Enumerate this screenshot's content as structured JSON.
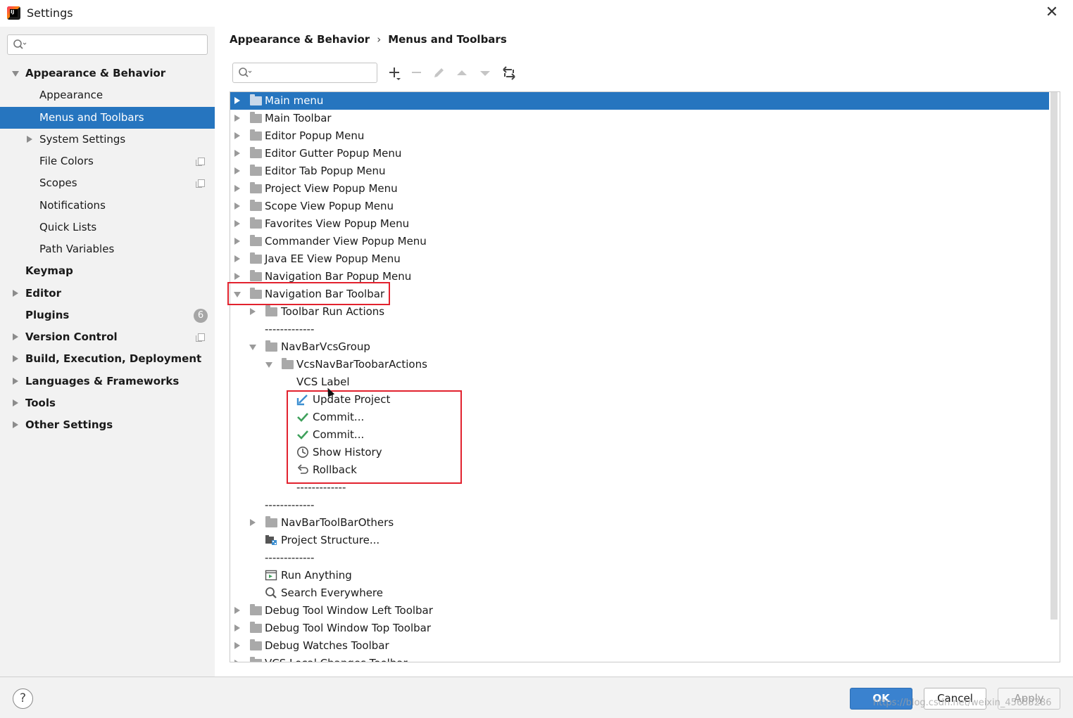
{
  "window": {
    "title": "Settings",
    "close_icon": "close-icon"
  },
  "sidebar": {
    "search_placeholder": "",
    "items": [
      {
        "label": "Appearance & Behavior",
        "bold": true,
        "expanded": true
      },
      {
        "label": "Appearance"
      },
      {
        "label": "Menus and Toolbars",
        "selected": true
      },
      {
        "label": "System Settings",
        "collapsed": true
      },
      {
        "label": "File Colors",
        "copy_icon": true
      },
      {
        "label": "Scopes",
        "copy_icon": true
      },
      {
        "label": "Notifications"
      },
      {
        "label": "Quick Lists"
      },
      {
        "label": "Path Variables"
      },
      {
        "label": "Keymap",
        "bold": true
      },
      {
        "label": "Editor",
        "bold": true,
        "collapsed": true
      },
      {
        "label": "Plugins",
        "bold": true,
        "badge": "6"
      },
      {
        "label": "Version Control",
        "bold": true,
        "collapsed": true,
        "copy_icon": true
      },
      {
        "label": "Build, Execution, Deployment",
        "bold": true,
        "collapsed": true
      },
      {
        "label": "Languages & Frameworks",
        "bold": true,
        "collapsed": true
      },
      {
        "label": "Tools",
        "bold": true,
        "collapsed": true
      },
      {
        "label": "Other Settings",
        "bold": true,
        "collapsed": true
      }
    ]
  },
  "breadcrumb": {
    "parent": "Appearance & Behavior",
    "separator": "›",
    "current": "Menus and Toolbars"
  },
  "toolbar": {
    "search_placeholder": "",
    "add_icon": "+",
    "remove_icon": "−",
    "edit_icon": "✎",
    "move_up_icon": "▲",
    "move_down_icon": "▼",
    "restore_icon": "⟲"
  },
  "tree": {
    "rows": [
      {
        "label": "Main menu"
      },
      {
        "label": "Main Toolbar"
      },
      {
        "label": "Editor Popup Menu"
      },
      {
        "label": "Editor Gutter Popup Menu"
      },
      {
        "label": "Editor Tab Popup Menu"
      },
      {
        "label": "Project View Popup Menu"
      },
      {
        "label": "Scope View Popup Menu"
      },
      {
        "label": "Favorites View Popup Menu"
      },
      {
        "label": "Commander View Popup Menu"
      },
      {
        "label": "Java EE View Popup Menu"
      },
      {
        "label": "Navigation Bar Popup Menu"
      },
      {
        "label": "Navigation Bar Toolbar"
      },
      {
        "label": "Toolbar Run Actions"
      },
      {
        "label": "-------------"
      },
      {
        "label": "NavBarVcsGroup"
      },
      {
        "label": "VcsNavBarToobarActions"
      },
      {
        "label": "VCS Label"
      },
      {
        "label": "Update Project"
      },
      {
        "label": "Commit..."
      },
      {
        "label": "Commit..."
      },
      {
        "label": "Show History"
      },
      {
        "label": "Rollback"
      },
      {
        "label": "-------------"
      },
      {
        "label": "-------------"
      },
      {
        "label": "NavBarToolBarOthers"
      },
      {
        "label": "Project Structure..."
      },
      {
        "label": "-------------"
      },
      {
        "label": "Run Anything"
      },
      {
        "label": "Search Everywhere"
      },
      {
        "label": "Debug Tool Window Left Toolbar"
      },
      {
        "label": "Debug Tool Window Top Toolbar"
      },
      {
        "label": "Debug Watches Toolbar"
      },
      {
        "label": "VCS Local Changes Toolbar"
      }
    ]
  },
  "footer": {
    "help_label": "?",
    "ok_label": "OK",
    "cancel_label": "Cancel",
    "apply_label": "Apply",
    "watermark": "https://blog.csdn.net/weixin_45653286"
  },
  "colors": {
    "selection": "#2675bf",
    "highlight_box": "#e2222e",
    "ok_button": "#3a82cf"
  }
}
